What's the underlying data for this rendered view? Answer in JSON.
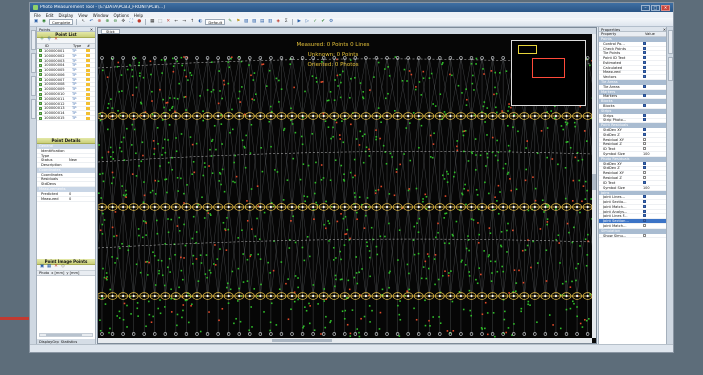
{
  "window": {
    "title": "Photo Measurement Tool - [E:\\DATA\\PCB3_FRONT\\PCB\\...]",
    "controls": [
      "–",
      "□",
      "✕"
    ]
  },
  "menu": [
    "File",
    "Edit",
    "Display",
    "View",
    "Window",
    "Options",
    "Help"
  ],
  "toolbar": {
    "mode_combo": "Complete",
    "display_combo": "Default"
  },
  "left_panel": {
    "pane_title": "Points",
    "point_list_title": "Point List",
    "columns": [
      "ID",
      "Type",
      "#"
    ],
    "points": [
      {
        "id": "100000001",
        "type": "TP"
      },
      {
        "id": "100000002",
        "type": "TP"
      },
      {
        "id": "100000003",
        "type": "TP"
      },
      {
        "id": "100000004",
        "type": "TP"
      },
      {
        "id": "100000005",
        "type": "TP"
      },
      {
        "id": "100000006",
        "type": "TP"
      },
      {
        "id": "100000007",
        "type": "TP"
      },
      {
        "id": "100000008",
        "type": "TP"
      },
      {
        "id": "100000009",
        "type": "TP"
      },
      {
        "id": "100000010",
        "type": "TP"
      },
      {
        "id": "100000011",
        "type": "TP"
      },
      {
        "id": "100000012",
        "type": "TP"
      },
      {
        "id": "100000013",
        "type": "TP"
      },
      {
        "id": "100000014",
        "type": "TP"
      },
      {
        "id": "100000015",
        "type": "TP"
      }
    ],
    "point_details_title": "Point Details",
    "details": [
      {
        "category": "General"
      },
      {
        "key": "Identification",
        "value": ""
      },
      {
        "key": "Type",
        "value": ""
      },
      {
        "key": "Status",
        "value": "New"
      },
      {
        "key": "Description",
        "value": ""
      },
      {
        "category": "Coordinates"
      },
      {
        "key": "Coordinates",
        "value": ""
      },
      {
        "key": "Residuals",
        "value": ""
      },
      {
        "key": "StdDevs",
        "value": ""
      },
      {
        "category": "Measurements"
      },
      {
        "key": "Predicted",
        "value": "0"
      },
      {
        "key": "Measured",
        "value": "0"
      }
    ],
    "image_points_title": "Point Image Points",
    "image_points_columns": [
      "Photo",
      "x [mm]",
      "y [mm]"
    ],
    "bottom_tabs": [
      "DisplayGrp",
      "Statistics"
    ]
  },
  "viewer": {
    "tab_label": "Stick",
    "overlay_lines": [
      "Measured: 0 Points 0 Lines",
      "Unknown: 0 Points",
      "Oriented: 0 Photos"
    ]
  },
  "right_panel": {
    "pane_title": "Properties",
    "columns": [
      "Property",
      "Value"
    ],
    "rows": [
      {
        "category": "Points"
      },
      {
        "key": "Control Po...",
        "value": "on"
      },
      {
        "key": "Check Points",
        "value": "on"
      },
      {
        "key": "Tie Points",
        "value": "on"
      },
      {
        "key": "Point ID Text",
        "value": "on"
      },
      {
        "key": "Estimated",
        "value": "on"
      },
      {
        "key": "Calculated",
        "value": "on"
      },
      {
        "key": "Measured",
        "value": "on"
      },
      {
        "key": "Vectors",
        "value": "on"
      },
      {
        "category": "Tie Areas"
      },
      {
        "key": "Tie Areas",
        "value": "on"
      },
      {
        "category": "Markers"
      },
      {
        "key": "Markers",
        "value": "on"
      },
      {
        "category": "Blocks"
      },
      {
        "key": "Blocks",
        "value": "on"
      },
      {
        "category": "Strips"
      },
      {
        "key": "Strips",
        "value": "on"
      },
      {
        "key": "Strip Photo...",
        "value": "on"
      },
      {
        "category": "Point Residuals"
      },
      {
        "key": "StdDev XY",
        "value": "on"
      },
      {
        "key": "StdDev Z",
        "value": "on"
      },
      {
        "key": "Residual XY",
        "value": "off"
      },
      {
        "key": "Residual Z",
        "value": "off"
      },
      {
        "key": "ID Text",
        "value": "off"
      },
      {
        "key": "Symbol Size",
        "value": "100"
      },
      {
        "category": "Photo Residuals"
      },
      {
        "key": "StdDev XY",
        "value": "on"
      },
      {
        "key": "StdDev Z",
        "value": "on"
      },
      {
        "key": "Residual XY",
        "value": "off"
      },
      {
        "key": "Residual Z",
        "value": "off"
      },
      {
        "key": "ID Text",
        "value": "on"
      },
      {
        "key": "Symbol Size",
        "value": "100"
      },
      {
        "category": "Joins"
      },
      {
        "key": "Joint Lines...",
        "value": "on"
      },
      {
        "key": "Joint Sectio...",
        "value": "on"
      },
      {
        "key": "Joint Match...",
        "value": "on"
      },
      {
        "key": "Joint Analys...",
        "value": "on"
      },
      {
        "key": "Joint Lines F...",
        "value": "on"
      },
      {
        "key": "Joint Section...",
        "value": "on",
        "selected": true
      },
      {
        "key": "Joint Match...",
        "value": "off"
      },
      {
        "category": "Simulation"
      },
      {
        "key": "Show Simu...",
        "value": "off"
      }
    ]
  },
  "colors": {
    "accent": "#c23a31",
    "point_green": "#2fbf2a",
    "point_red": "#e24a2a",
    "strip_yellow": "#f2c94c",
    "selection": "#3b73c6"
  }
}
